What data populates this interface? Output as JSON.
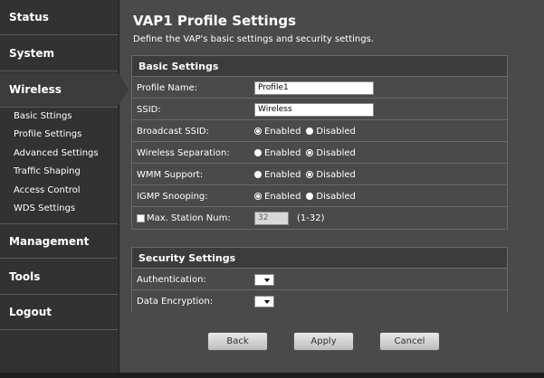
{
  "sidebar": {
    "status": "Status",
    "system": "System",
    "wireless": "Wireless",
    "sub": [
      "Basic Sttings",
      "Profile Settings",
      "Advanced Settings",
      "Traffic Shaping",
      "Access Control",
      "WDS Settings"
    ],
    "management": "Management",
    "tools": "Tools",
    "logout": "Logout"
  },
  "page": {
    "title": "VAP1 Profile Settings",
    "description": "Define the VAP's basic settings and security settings."
  },
  "basic": {
    "header": "Basic Settings",
    "profile_name_label": "Profile Name:",
    "profile_name_value": "Profile1",
    "ssid_label": "SSID:",
    "ssid_value": "Wireless",
    "broadcast_label": "Broadcast SSID:",
    "separation_label": "Wireless Separation:",
    "wmm_label": "WMM Support:",
    "igmp_label": "IGMP Snooping:",
    "enabled": "Enabled",
    "disabled": "Disabled",
    "max_station_label": "Max. Station Num:",
    "max_station_value": "32",
    "max_station_range": "(1-32)"
  },
  "security": {
    "header": "Security Settings",
    "auth_label": "Authentication:",
    "encryption_label": "Data Encryption:"
  },
  "buttons": {
    "back": "Back",
    "apply": "Apply",
    "cancel": "Cancel"
  }
}
